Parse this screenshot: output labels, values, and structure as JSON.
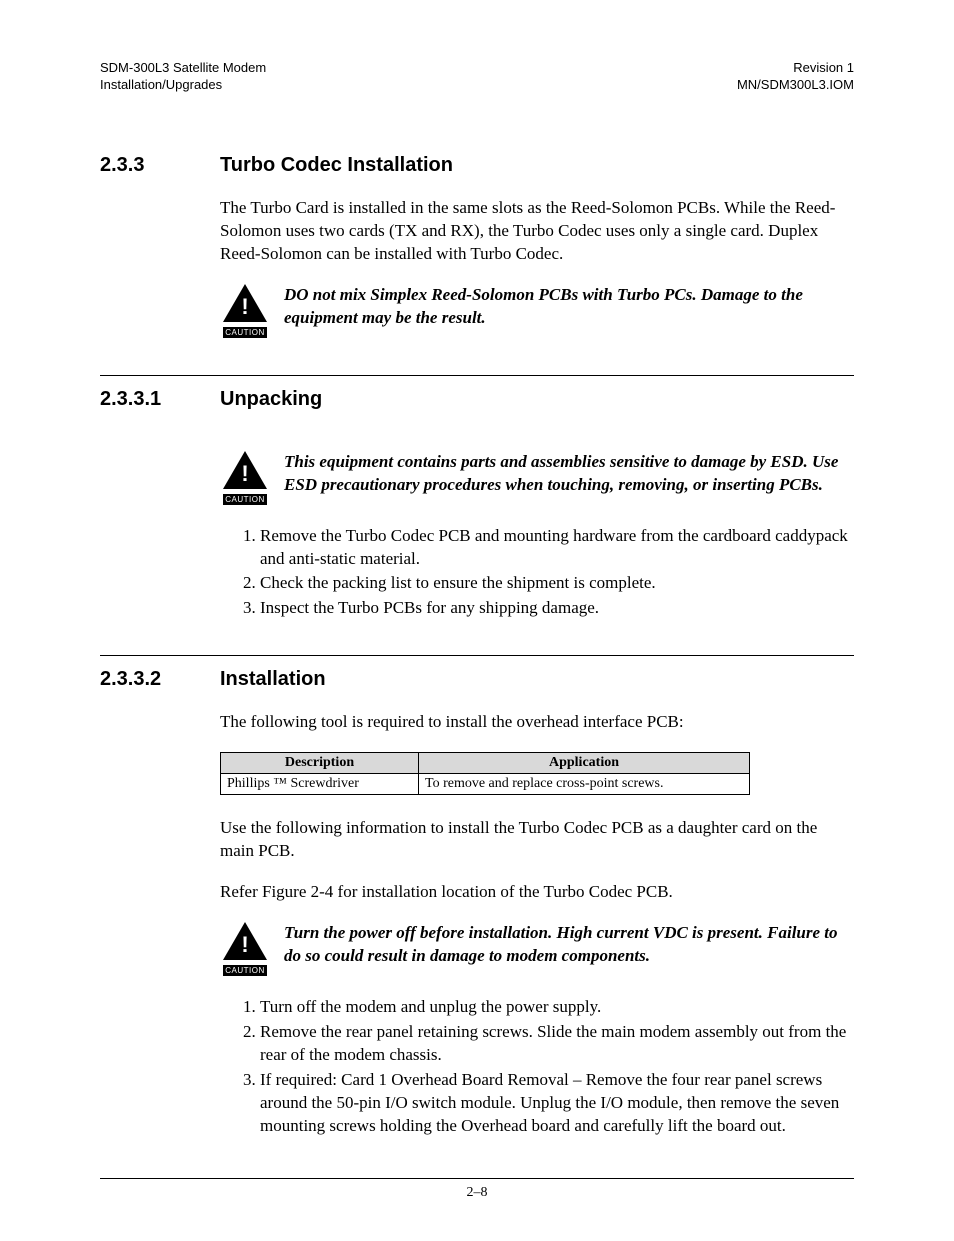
{
  "header": {
    "left_line1": "SDM-300L3 Satellite Modem",
    "left_line2": "Installation/Upgrades",
    "right_line1": "Revision 1",
    "right_line2": "MN/SDM300L3.IOM"
  },
  "sections": {
    "s233": {
      "number": "2.3.3",
      "title": "Turbo Codec Installation",
      "intro": "The Turbo Card is installed in the same slots as the Reed-Solomon PCBs. While the Reed-Solomon uses two cards (TX and RX), the Turbo Codec uses only a single card. Duplex Reed-Solomon can be installed with Turbo Codec.",
      "caution": "DO not mix Simplex Reed-Solomon PCBs with Turbo PCs. Damage to the equipment may be the result."
    },
    "s2331": {
      "number": "2.3.3.1",
      "title": "Unpacking",
      "caution": "This equipment contains parts and assemblies sensitive to damage by ESD. Use ESD precautionary procedures when touching, removing, or inserting PCBs.",
      "steps": [
        "Remove the Turbo Codec PCB and mounting hardware from the cardboard caddypack and anti-static material.",
        "Check the packing list to ensure the shipment is complete.",
        "Inspect the Turbo PCBs for any shipping damage."
      ]
    },
    "s2332": {
      "number": "2.3.3.2",
      "title": "Installation",
      "intro": "The following tool is required to install the overhead interface PCB:",
      "table": {
        "head_description": "Description",
        "head_application": "Application",
        "row_description": "Phillips ™ Screwdriver",
        "row_application": "To remove and replace cross-point screws."
      },
      "para2": "Use the following information to install the Turbo Codec PCB as a daughter card on the main PCB.",
      "para3": "Refer Figure 2-4 for installation location of the Turbo Codec PCB.",
      "caution": "Turn the power off before installation. High current VDC is present. Failure to do so could result in damage to modem components.",
      "steps": [
        "Turn off the modem and unplug the power supply.",
        "Remove the rear panel retaining screws. Slide the main modem assembly out from the rear of the modem chassis.",
        "If required: Card 1 Overhead Board Removal – Remove the four rear panel screws around the 50-pin I/O switch module. Unplug the I/O module, then remove the seven mounting screws holding the Overhead board and carefully lift the board out."
      ]
    }
  },
  "caution_label": "CAUTION",
  "footer": "2–8"
}
